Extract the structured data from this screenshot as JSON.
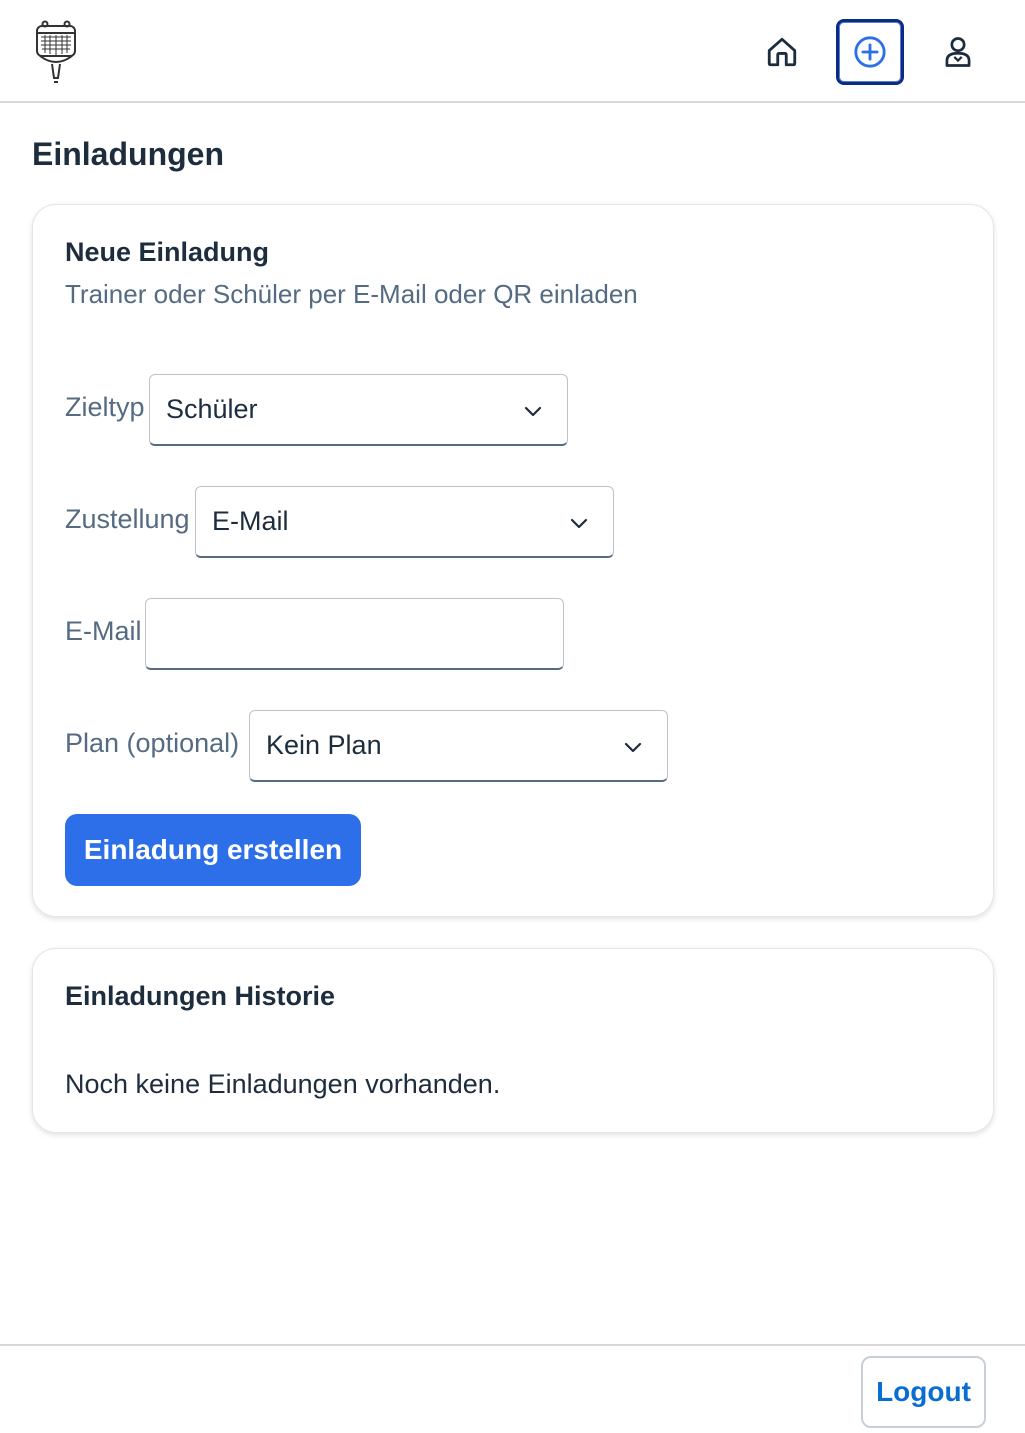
{
  "header": {
    "logo_icon": "tennis-racket-calendar-icon",
    "nav": {
      "home_icon": "home-icon",
      "add_icon": "add-circle-icon",
      "user_icon": "user-icon"
    }
  },
  "page": {
    "title": "Einladungen"
  },
  "new_invite": {
    "title": "Neue Einladung",
    "subtitle": "Trainer oder Schüler per E-Mail oder QR einladen",
    "fields": {
      "target_type": {
        "label": "Zieltyp",
        "value": "Schüler"
      },
      "delivery": {
        "label": "Zustellung",
        "value": "E-Mail"
      },
      "email": {
        "label": "E-Mail",
        "value": "",
        "placeholder": ""
      },
      "plan": {
        "label": "Plan (optional)",
        "value": "Kein Plan"
      }
    },
    "submit_label": "Einladung erstellen"
  },
  "history": {
    "title": "Einladungen Historie",
    "empty_text": "Noch keine Einladungen vorhanden."
  },
  "footer": {
    "logout_label": "Logout"
  },
  "colors": {
    "primary": "#2d6fe8",
    "focus_border": "#0a2d84",
    "link": "#0a6ed1",
    "muted_text": "#556b82"
  }
}
